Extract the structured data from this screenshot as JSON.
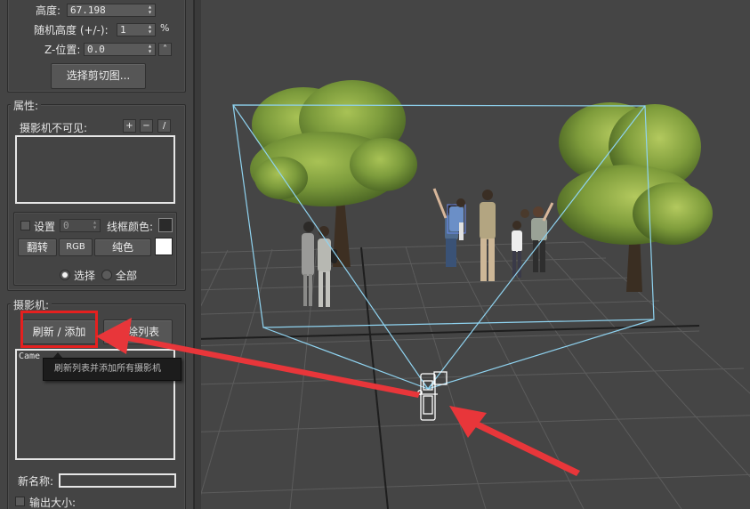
{
  "top_params": {
    "height_label": "高度:",
    "height_value": "67.198",
    "random_height_label": "随机高度 (+/-):",
    "random_height_value": "1",
    "random_height_unit": "%",
    "z_position_label": "Z-位置:",
    "z_position_value": "0.0",
    "select_clip_button": "选择剪切图..."
  },
  "properties": {
    "title": "属性:",
    "camera_invisible_label": "摄影机不可见:",
    "add_symbol": "+",
    "remove_symbol": "−",
    "edit_symbol": "/",
    "settings_label": "设置",
    "settings_value": "0",
    "wire_color_label": "线框颜色:",
    "flip_button": "翻转",
    "rgb_button": "RGB",
    "solid_color_button": "纯色",
    "select_radio_label": "选择",
    "all_radio_label": "全部"
  },
  "camera": {
    "title": "摄影机:",
    "refresh_add_button": "刷新 / 添加",
    "clear_list_button": "清除列表",
    "list_items": [
      "Came"
    ],
    "new_name_label": "新名称:",
    "new_name_value": "",
    "output_size_label": "输出大小:"
  },
  "tooltip": {
    "text": "刷新列表并添加所有摄影机"
  },
  "colors": {
    "highlight": "#e5201f",
    "arrow": "#e8363a",
    "frustum": "#8fd3f0",
    "wire_color_swatch": "#2a2a2a",
    "solid_color_swatch": "#ffffff"
  },
  "icons": {
    "spinner": "up-down-arrows-icon",
    "camera": "camera-gizmo-icon"
  }
}
